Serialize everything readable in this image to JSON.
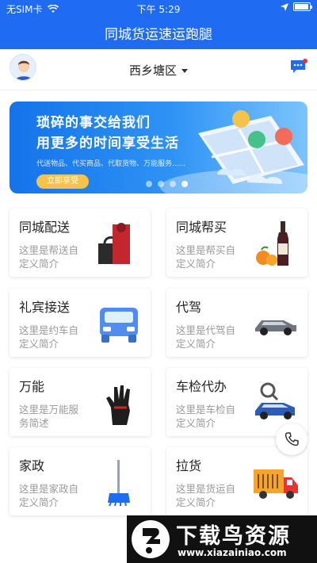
{
  "status_bar": {
    "carrier": "无SIM卡",
    "time": "下午 5:29"
  },
  "nav": {
    "title": "同城货运速运跑腿"
  },
  "header": {
    "location": "西乡塘区"
  },
  "banner": {
    "line1": "琐碎的事交给我们",
    "line2": "用更多的时间享受生活",
    "sub": "代送物品、代买商品、代取货物、万能服务......",
    "button": "立即享受",
    "dots": 4,
    "active_dot": 3
  },
  "services": [
    {
      "title": "同城配送",
      "desc": "这里是帮送自定义简介",
      "icon": "gift-bag-icon"
    },
    {
      "title": "同城帮买",
      "desc": "这里是帮买自定义简介",
      "icon": "wine-fruit-icon"
    },
    {
      "title": "礼宾接送",
      "desc": "这里是约车自定义简介",
      "icon": "car-front-icon"
    },
    {
      "title": "代驾",
      "desc": "这里是代驾自定义简介",
      "icon": "sedan-icon"
    },
    {
      "title": "万能",
      "desc": "这里是万能服务简述",
      "icon": "glove-icon"
    },
    {
      "title": "车检代办",
      "desc": "这里是车检自定义简介",
      "icon": "car-inspection-icon"
    },
    {
      "title": "家政",
      "desc": "这里是家政自定义简介",
      "icon": "mop-icon"
    },
    {
      "title": "拉货",
      "desc": "这里是货运自定义简介",
      "icon": "truck-icon"
    }
  ],
  "watermark": {
    "title": "下载鸟资源",
    "url": "www.xiazainiao.com"
  },
  "colors": {
    "primary": "#1f6bf2",
    "banner_button": "#f6c34a",
    "badge": "#e8342f"
  }
}
